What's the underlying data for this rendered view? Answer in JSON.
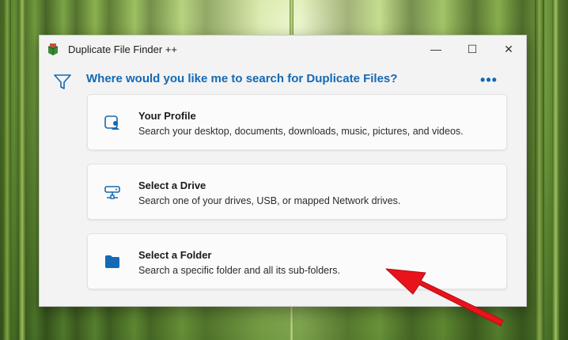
{
  "window": {
    "title": "Duplicate File Finder ++",
    "minimize_glyph": "—",
    "maximize_glyph": "☐",
    "close_glyph": "✕"
  },
  "main": {
    "question": "Where would you like me to search for Duplicate Files?",
    "more_glyph": "•••"
  },
  "options": [
    {
      "title": "Your Profile",
      "description": "Search your desktop, documents, downloads, music, pictures, and videos.",
      "icon": "user-profile-icon"
    },
    {
      "title": "Select a Drive",
      "description": "Search one of your drives, USB, or mapped Network drives.",
      "icon": "network-drive-icon"
    },
    {
      "title": "Select a Folder",
      "description": "Search a specific folder and all its sub-folders.",
      "icon": "folder-icon"
    }
  ],
  "colors": {
    "accent": "#1469b4",
    "annotation_arrow": "#e8131b"
  }
}
